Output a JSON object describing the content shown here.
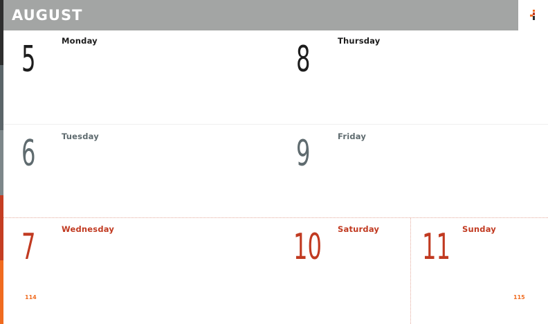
{
  "header": {
    "month": "AUGUST"
  },
  "colors": {
    "header_bg": "#a3a5a4",
    "text_dark": "#1d1d1d",
    "text_gray": "#5f6b6f",
    "text_red": "#c13a21",
    "accent_orange": "#f06b1f"
  },
  "days": {
    "monday": {
      "number": "5",
      "name": "Monday"
    },
    "tuesday": {
      "number": "6",
      "name": "Tuesday"
    },
    "wednesday": {
      "number": "7",
      "name": "Wednesday"
    },
    "thursday": {
      "number": "8",
      "name": "Thursday"
    },
    "friday": {
      "number": "9",
      "name": "Friday"
    },
    "saturday": {
      "number": "10",
      "name": "Saturday"
    },
    "sunday": {
      "number": "11",
      "name": "Sunday"
    }
  },
  "page_numbers": {
    "left": "114",
    "right": "115"
  },
  "logo_icon": "planner-brand-logo-icon"
}
